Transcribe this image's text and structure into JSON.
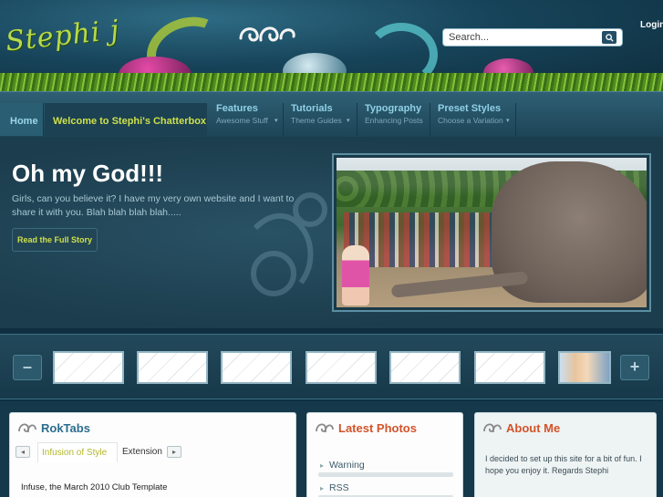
{
  "header": {
    "logo_text": "Stephi j",
    "search_placeholder": "Search...",
    "login_label": "Login"
  },
  "nav": {
    "home": "Home",
    "active": "Welcome to Stephi's Chatterbox",
    "items": [
      {
        "title": "Features",
        "subtitle": "Awesome Stuff"
      },
      {
        "title": "Tutorials",
        "subtitle": "Theme Guides"
      },
      {
        "title": "Typography",
        "subtitle": "Enhancing Posts"
      },
      {
        "title": "Preset Styles",
        "subtitle": "Choose a Variation"
      }
    ]
  },
  "showcase": {
    "headline": "Oh my God!!!",
    "intro": "Girls, can you believe it? I have my very own website and I want to share it with you. Blah blah blah blah.....",
    "read_more": "Read the Full Story"
  },
  "carousel": {
    "prev_label": "–",
    "next_label": "+"
  },
  "modules": {
    "roktabs": {
      "title": "RokTabs",
      "tab_prev": "◂",
      "tab_next": "▸",
      "tab_active": "Infusion of Style",
      "tab_other": "Extension",
      "body": "Infuse, the March 2010 Club Template"
    },
    "latest_photos": {
      "title": "Latest Photos",
      "links": [
        "Warning",
        "RSS"
      ]
    },
    "about": {
      "title": "About Me",
      "text": "I decided to set up this site for a bit of fun. I hope you enjoy it. Regards Stephi"
    }
  },
  "colors": {
    "accent_green": "#cde04a",
    "nav_blue": "#8fd0e6",
    "title_orange": "#d2542a",
    "title_blue": "#2b6d8e"
  }
}
